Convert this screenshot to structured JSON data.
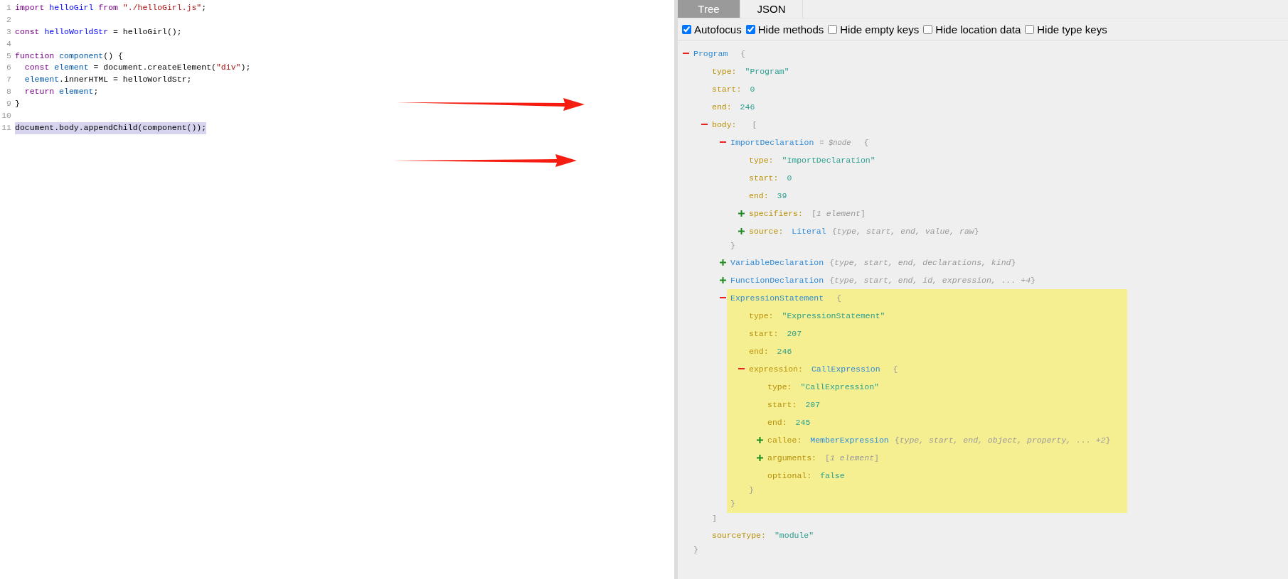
{
  "editor": {
    "lines": [
      {
        "number": "1",
        "selected": false,
        "tokens": [
          {
            "text": "import ",
            "kind": "keyword"
          },
          {
            "text": "helloGirl ",
            "kind": "def"
          },
          {
            "text": "from ",
            "kind": "keyword"
          },
          {
            "text": "\"./helloGirl.js\"",
            "kind": "string"
          },
          {
            "text": ";",
            "kind": "plain"
          }
        ]
      },
      {
        "number": "2"
      },
      {
        "number": "3",
        "selected": false,
        "tokens": [
          {
            "text": "const ",
            "kind": "keyword"
          },
          {
            "text": "helloWorldStr",
            "kind": "def"
          },
          {
            "text": " = helloGirl();",
            "kind": "plain"
          }
        ]
      },
      {
        "number": "4"
      },
      {
        "number": "5",
        "selected": false,
        "tokens": [
          {
            "text": "function ",
            "kind": "keyword"
          },
          {
            "text": "component",
            "kind": "variable"
          },
          {
            "text": "() {",
            "kind": "plain"
          }
        ]
      },
      {
        "number": "6",
        "selected": false,
        "indented": true,
        "tokens": [
          {
            "text": "const ",
            "kind": "keyword"
          },
          {
            "text": "element",
            "kind": "variable"
          },
          {
            "text": " = document.createElement(",
            "kind": "plain"
          },
          {
            "text": "\"div\"",
            "kind": "string"
          },
          {
            "text": ");",
            "kind": "plain"
          }
        ]
      },
      {
        "number": "7",
        "selected": false,
        "indented": true,
        "tokens": [
          {
            "text": "element",
            "kind": "variable"
          },
          {
            "text": ".innerHTML = helloWorldStr;",
            "kind": "plain"
          }
        ]
      },
      {
        "number": "8",
        "selected": false,
        "indented": true,
        "tokens": [
          {
            "text": "return ",
            "kind": "keyword"
          },
          {
            "text": "element",
            "kind": "variable"
          },
          {
            "text": ";",
            "kind": "plain"
          }
        ]
      },
      {
        "number": "9",
        "selected": false,
        "tokens": [
          {
            "text": "}",
            "kind": "plain"
          }
        ]
      },
      {
        "number": "10"
      },
      {
        "number": "11",
        "selected": true,
        "tokens": [
          {
            "text": "document.body.appendChild(component());",
            "kind": "plain"
          }
        ]
      }
    ]
  },
  "tabs": [
    {
      "label": "Tree",
      "selected": true
    },
    {
      "label": "JSON",
      "selected": false
    }
  ],
  "options": [
    {
      "label": "Autofocus",
      "checked": true
    },
    {
      "label": "Hide methods",
      "checked": true
    },
    {
      "label": "Hide empty keys",
      "checked": false
    },
    {
      "label": "Hide location data",
      "checked": false
    },
    {
      "label": "Hide type keys",
      "checked": false
    }
  ],
  "tree": {
    "label": "Program",
    "open": "{",
    "expanded": true,
    "close": "}",
    "children": [
      {
        "key": "type:",
        "value": "\"Program\""
      },
      {
        "key": "start:",
        "value": "0"
      },
      {
        "key": "end:",
        "value": "246"
      },
      {
        "key": "body:",
        "open": "[",
        "expanded": true,
        "close": "]",
        "children": [
          {
            "label": "ImportDeclaration",
            "annotation": "= $node",
            "open": "{",
            "expanded": true,
            "close": "}",
            "children": [
              {
                "key": "type:",
                "value": "\"ImportDeclaration\""
              },
              {
                "key": "start:",
                "value": "0"
              },
              {
                "key": "end:",
                "value": "39"
              },
              {
                "key": "specifiers:",
                "summary": "[*1 element*]",
                "expanded": false
              },
              {
                "key": "source:",
                "label": "Literal",
                "summary": "{*type, start, end, value, raw*}",
                "expanded": false
              }
            ]
          },
          {
            "label": "VariableDeclaration",
            "summary": "{*type, start, end, declarations, kind*}",
            "expanded": false
          },
          {
            "label": "FunctionDeclaration",
            "summary": "{*type, start, end, id, expression, ... +4*}",
            "expanded": false
          },
          {
            "label": "ExpressionStatement",
            "open": "{",
            "expanded": true,
            "highlighted": true,
            "close": "}",
            "children": [
              {
                "key": "type:",
                "value": "\"ExpressionStatement\""
              },
              {
                "key": "start:",
                "value": "207"
              },
              {
                "key": "end:",
                "value": "246"
              },
              {
                "key": "expression:",
                "label": "CallExpression",
                "open": "{",
                "expanded": true,
                "close": "}",
                "children": [
                  {
                    "key": "type:",
                    "value": "\"CallExpression\""
                  },
                  {
                    "key": "start:",
                    "value": "207"
                  },
                  {
                    "key": "end:",
                    "value": "245"
                  },
                  {
                    "key": "callee:",
                    "label": "MemberExpression",
                    "summary": "{*type, start, end, object, property, ... +2*}",
                    "expanded": false
                  },
                  {
                    "key": "arguments:",
                    "summary": "[*1 element*]",
                    "expanded": false
                  },
                  {
                    "key": "optional:",
                    "value": "false"
                  }
                ]
              }
            ]
          }
        ]
      },
      {
        "key": "sourceType:",
        "value": "\"module\""
      }
    ]
  }
}
